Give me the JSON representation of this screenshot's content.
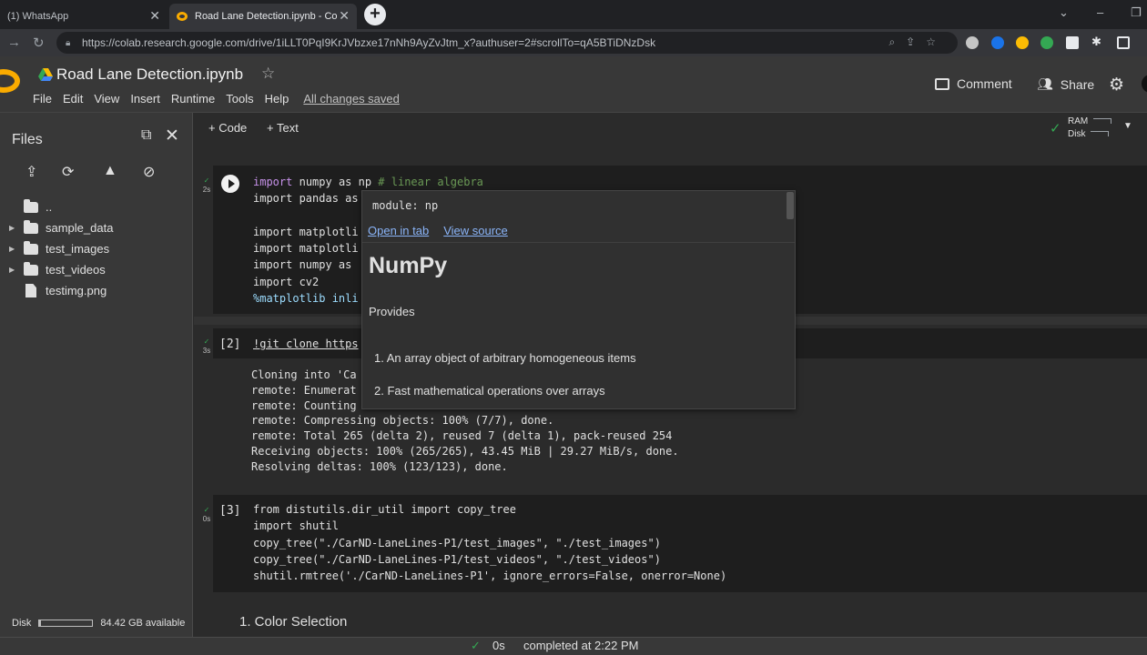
{
  "browser": {
    "tabs": [
      {
        "label": "(1) WhatsApp",
        "close": "✕"
      },
      {
        "label": "Road Lane Detection.ipynb - Co",
        "close": "✕"
      }
    ],
    "new_tab": "+",
    "url": "https://colab.research.google.com/drive/1iLLT0PqI9KrJVbzxe17nNh9AyZvJtm_x?authuser=2#scrollTo=qA5BTiDNzDsk"
  },
  "colab": {
    "title": "Road Lane Detection.ipynb",
    "menu": [
      "File",
      "Edit",
      "View",
      "Insert",
      "Runtime",
      "Tools",
      "Help"
    ],
    "saved_status": "All changes saved",
    "comment_label": "Comment",
    "share_label": "Share"
  },
  "sidebar": {
    "title": "Files",
    "tree": [
      {
        "name": "..",
        "type": "parent"
      },
      {
        "name": "sample_data",
        "type": "folder"
      },
      {
        "name": "test_images",
        "type": "folder"
      },
      {
        "name": "test_videos",
        "type": "folder"
      },
      {
        "name": "testimg.png",
        "type": "file"
      }
    ],
    "disk_label": "Disk",
    "disk_available": "84.42 GB available",
    "disk_used_fraction": 0.03
  },
  "toolbar": {
    "code_label": "+ Code",
    "text_label": "+ Text",
    "ram_label": "RAM",
    "disk_label": "Disk"
  },
  "cells": [
    {
      "gutter_check": "✓",
      "gutter_time": "2s",
      "lines": [
        "import numpy as np # linear algebra",
        "import pandas as",
        "",
        "import matplotli",
        "import matplotli",
        "import numpy as",
        "import cv2",
        "%matplotlib inli"
      ]
    },
    {
      "exec_count": "[2]",
      "gutter_check": "✓",
      "gutter_time": "3s",
      "lines": [
        "!git clone https"
      ],
      "output": [
        "Cloning into 'Ca",
        "remote: Enumerat",
        "remote: Counting",
        "remote: Compressing objects: 100% (7/7), done.",
        "remote: Total 265 (delta 2), reused 7 (delta 1), pack-reused 254",
        "Receiving objects: 100% (265/265), 43.45 MiB | 29.27 MiB/s, done.",
        "Resolving deltas: 100% (123/123), done."
      ]
    },
    {
      "exec_count": "[3]",
      "gutter_check": "✓",
      "gutter_time": "0s",
      "lines": [
        "from distutils.dir_util import copy_tree",
        "import shutil",
        "copy_tree(\"./CarND-LaneLines-P1/test_images\", \"./test_images\")",
        "copy_tree(\"./CarND-LaneLines-P1/test_videos\", \"./test_videos\")",
        "shutil.rmtree('./CarND-LaneLines-P1', ignore_errors=False, onerror=None)"
      ]
    }
  ],
  "section_heading": "1. Color Selection",
  "tooltip": {
    "module": "module: np",
    "open_in_tab": "Open in tab",
    "view_source": "View source",
    "title": "NumPy",
    "provides": "Provides",
    "items": [
      "1. An array object of arbitrary homogeneous items",
      "2. Fast mathematical operations over arrays"
    ]
  },
  "status": {
    "check": "✓",
    "duration": "0s",
    "completed": "completed at 2:22 PM"
  },
  "colors": {
    "accent_green": "#34a853",
    "link_blue": "#8ab4f8",
    "colab_orange": "#f9ab00"
  }
}
